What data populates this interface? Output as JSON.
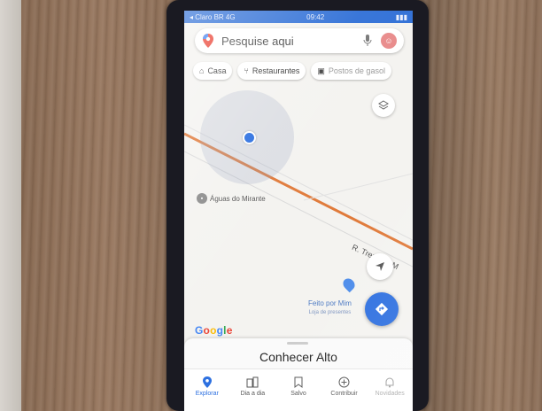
{
  "status_bar": {
    "carrier": "◂ Claro BR 4G",
    "time": "09:42"
  },
  "search": {
    "placeholder": "Pesquise aqui"
  },
  "chips": [
    {
      "label": "Casa",
      "icon": "home-icon"
    },
    {
      "label": "Restaurantes",
      "icon": "fork-knife-icon"
    },
    {
      "label": "Postos de gasol",
      "icon": "gas-pump-icon"
    }
  ],
  "map": {
    "poi_label": "Águas do Mirante",
    "street_label": "R. Treze de M",
    "place_name": "Feito por Mim",
    "place_category": "Loja de presentes",
    "logo": "Google"
  },
  "sheet": {
    "title": "Conhecer Alto"
  },
  "nav": [
    {
      "label": "Explorar",
      "icon": "pin-icon",
      "active": true
    },
    {
      "label": "Dia a dia",
      "icon": "commute-icon",
      "active": false
    },
    {
      "label": "Salvo",
      "icon": "bookmark-icon",
      "active": false
    },
    {
      "label": "Contribuir",
      "icon": "plus-circle-icon",
      "active": false
    },
    {
      "label": "Novidades",
      "icon": "bell-icon",
      "active": false
    }
  ],
  "colors": {
    "accent": "#2b6fe0",
    "road": "#e07a3a",
    "status_bar": "#2f6fd6"
  }
}
